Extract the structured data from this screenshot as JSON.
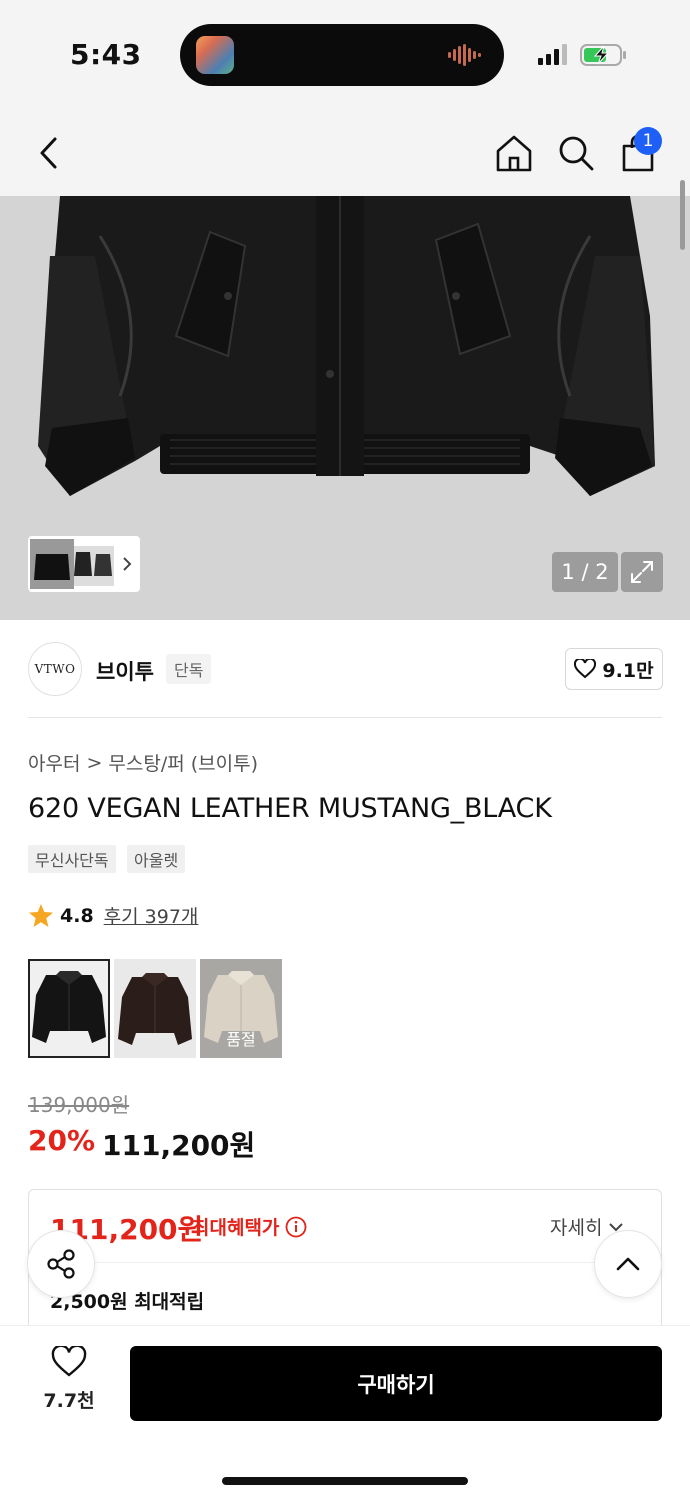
{
  "status_bar": {
    "time": "5:43"
  },
  "nav": {
    "cart_count": "1"
  },
  "gallery": {
    "counter": "1 / 2"
  },
  "brand": {
    "logo_text": "VTWO",
    "name": "브이투",
    "tag": "단독",
    "like_count": "9.1만"
  },
  "breadcrumb": {
    "level1": "아우터",
    "separator": ">",
    "level2": "무스탕/퍼 (브이투)"
  },
  "product": {
    "title": "620 VEGAN LEATHER MUSTANG_BLACK",
    "tags": [
      "무신사단독",
      "아울렛"
    ],
    "rating": "4.8",
    "reviews": "후기 397개",
    "color_options": [
      {
        "name": "black",
        "sold_out": false
      },
      {
        "name": "brown",
        "sold_out": false
      },
      {
        "name": "ivory",
        "sold_out": true,
        "label": "품절"
      }
    ],
    "original_price": "139,000원",
    "discount": "20%",
    "sale_price": "111,200원"
  },
  "benefit": {
    "max_price": "111,200원",
    "max_label": "최대혜택가",
    "detail_link": "자세히",
    "points": "2,500원 최대적립"
  },
  "bottom_bar": {
    "like_count": "7.7천",
    "buy_label": "구매하기"
  },
  "colors": {
    "accent_red": "#e3241b",
    "badge_blue": "#1e5ff5",
    "buy_button": "#000000"
  }
}
